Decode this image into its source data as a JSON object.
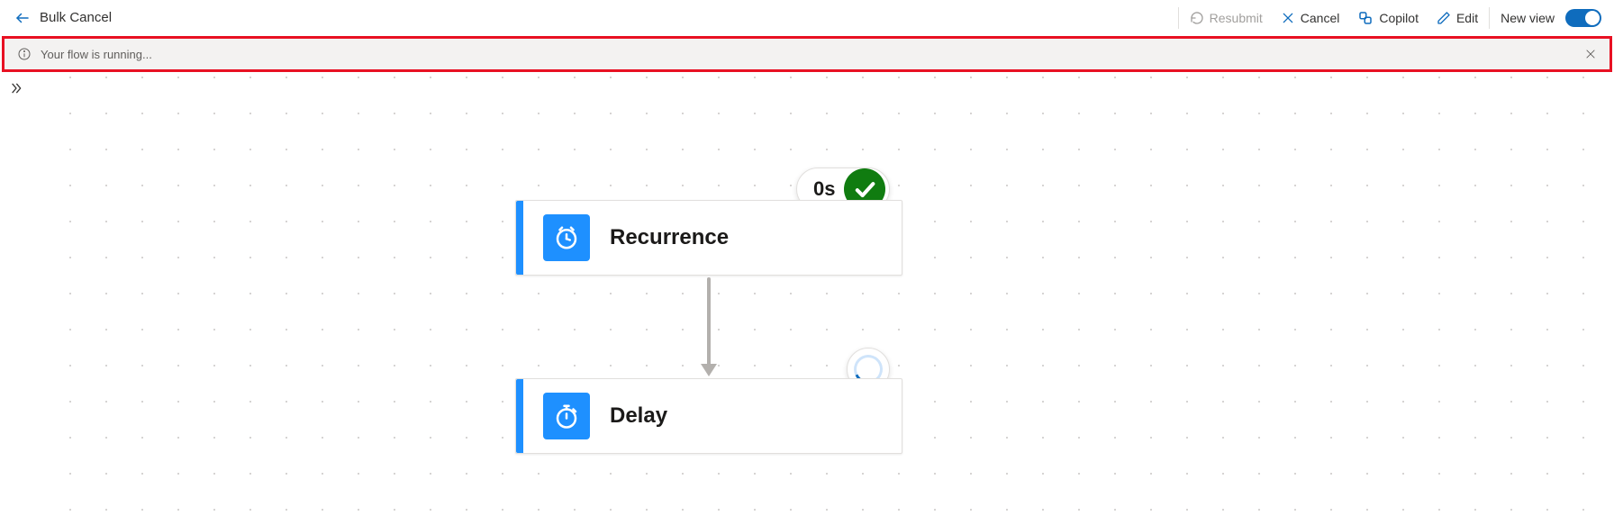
{
  "header": {
    "title": "Bulk Cancel",
    "commands": {
      "resubmit": "Resubmit",
      "cancel": "Cancel",
      "copilot": "Copilot",
      "edit": "Edit",
      "newview": "New view"
    }
  },
  "notification": {
    "message": "Your flow is running..."
  },
  "flow": {
    "steps": [
      {
        "label": "Recurrence",
        "status": "succeeded",
        "duration": "0s"
      },
      {
        "label": "Delay",
        "status": "running"
      }
    ]
  }
}
